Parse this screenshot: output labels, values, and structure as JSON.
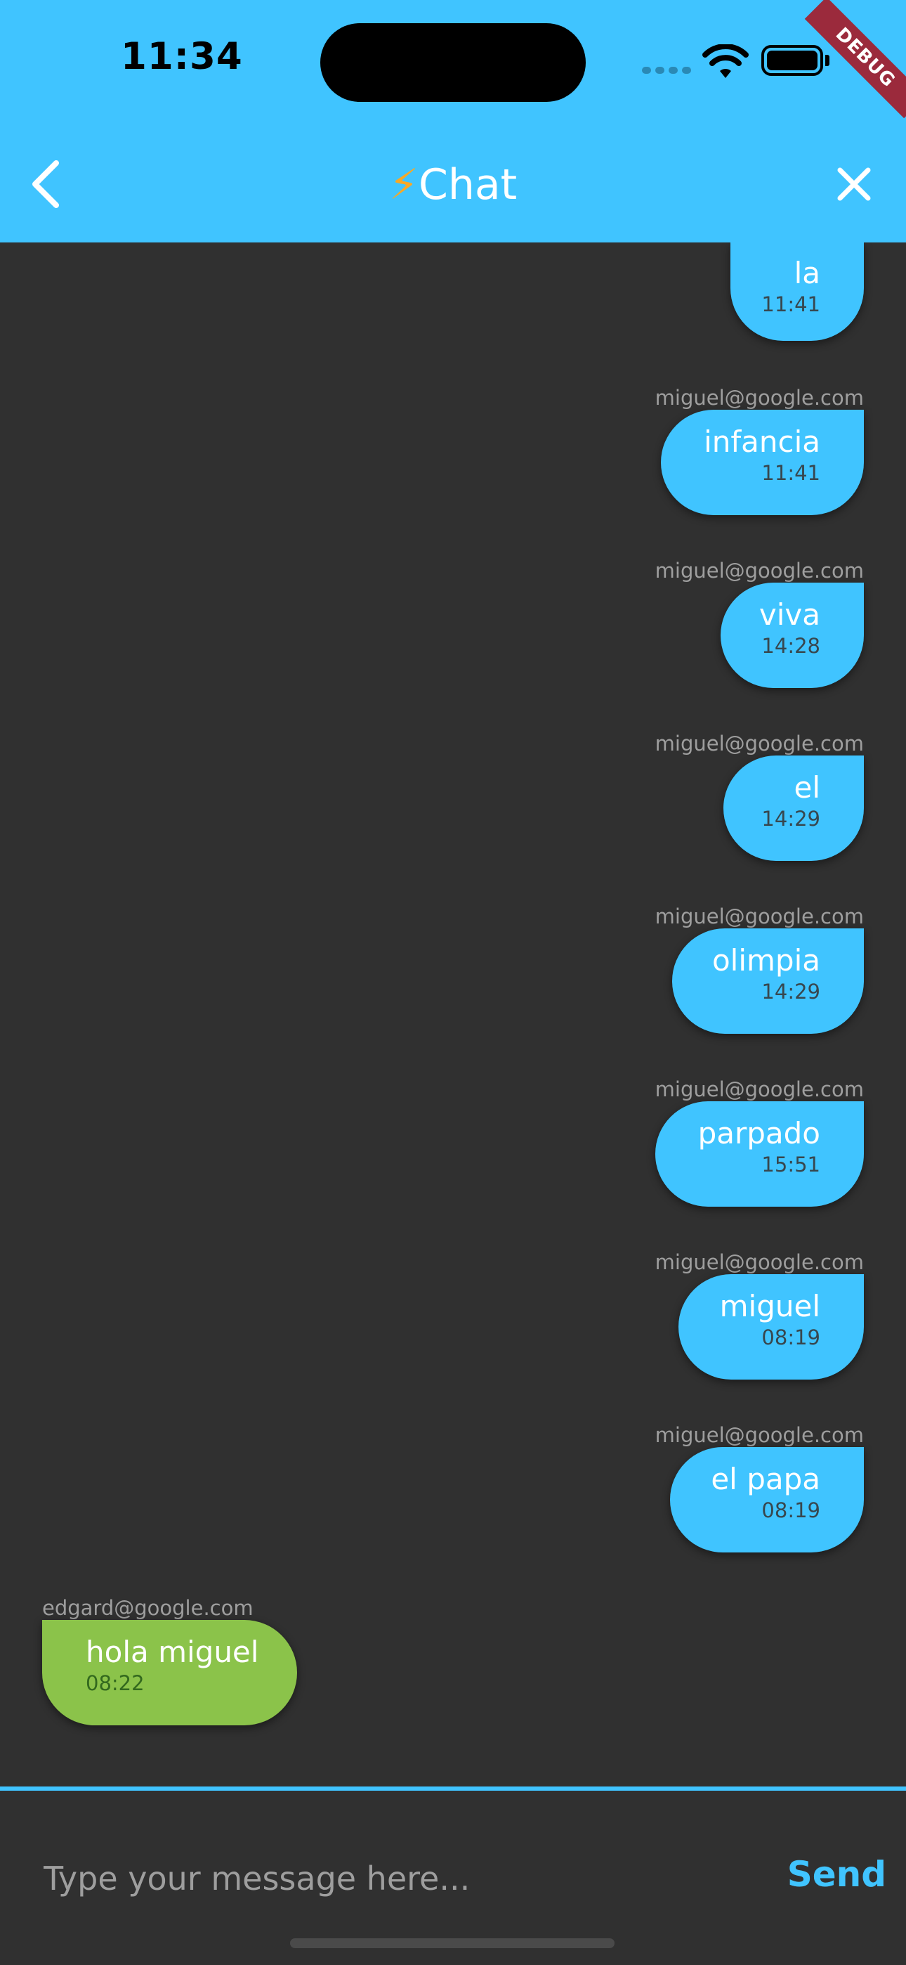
{
  "status_bar": {
    "time": "11:34"
  },
  "debug_banner": "DEBUG",
  "header": {
    "title_icon": "⚡",
    "title": "Chat",
    "back_icon": "chevron-left-icon",
    "close_icon": "close-icon"
  },
  "messages": [
    {
      "sender": "",
      "text": "la",
      "time": "11:41",
      "own": true
    },
    {
      "sender": "miguel@google.com",
      "text": "infancia",
      "time": "11:41",
      "own": true
    },
    {
      "sender": "miguel@google.com",
      "text": "viva",
      "time": "14:28",
      "own": true
    },
    {
      "sender": "miguel@google.com",
      "text": "el",
      "time": "14:29",
      "own": true
    },
    {
      "sender": "miguel@google.com",
      "text": "olimpia",
      "time": "14:29",
      "own": true
    },
    {
      "sender": "miguel@google.com",
      "text": "parpado",
      "time": "15:51",
      "own": true
    },
    {
      "sender": "miguel@google.com",
      "text": "miguel",
      "time": "08:19",
      "own": true
    },
    {
      "sender": "miguel@google.com",
      "text": "el papa",
      "time": "08:19",
      "own": true
    },
    {
      "sender": "edgard@google.com",
      "text": "hola miguel",
      "time": "08:22",
      "own": false
    }
  ],
  "composer": {
    "placeholder": "Type your message here...",
    "value": "",
    "send_label": "Send"
  },
  "colors": {
    "accent": "#40c4ff",
    "background": "#303030",
    "own_bubble": "#40c4ff",
    "other_bubble": "#8bc34a"
  }
}
